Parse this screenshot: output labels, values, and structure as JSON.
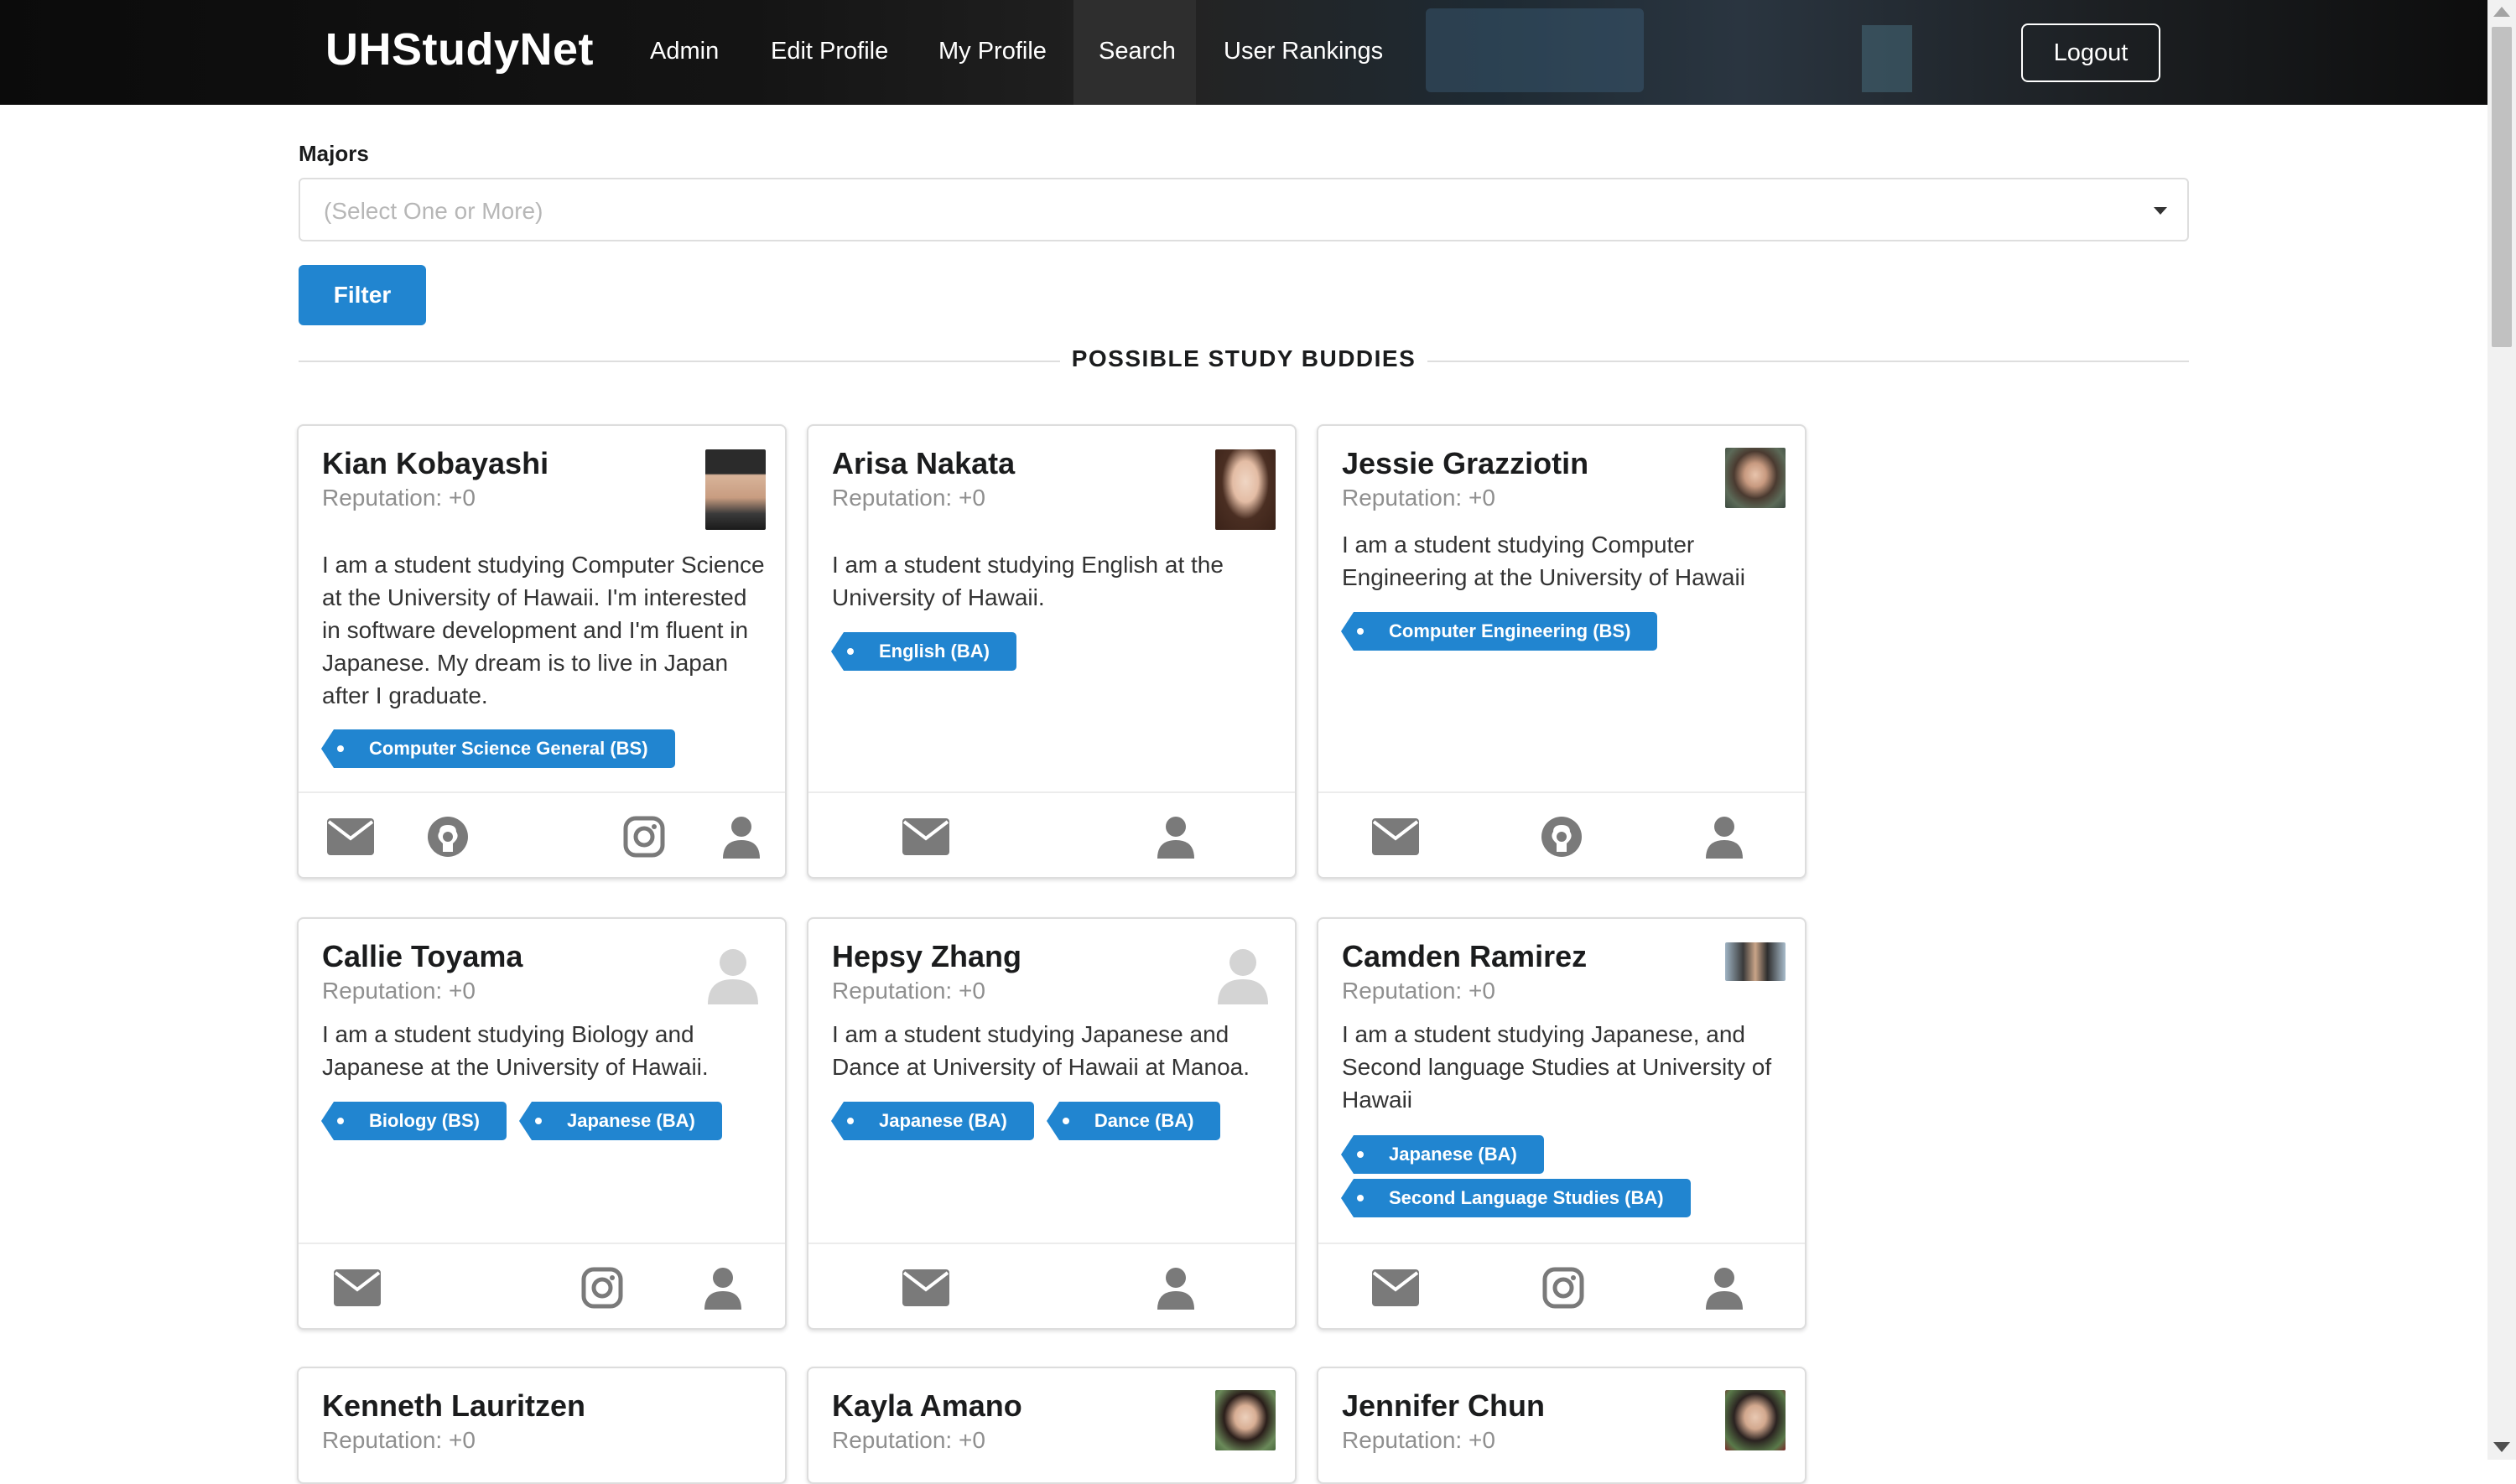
{
  "navbar": {
    "brand": "UHStudyNet",
    "items": [
      {
        "label": "Admin"
      },
      {
        "label": "Edit Profile"
      },
      {
        "label": "My Profile"
      },
      {
        "label": "Search"
      },
      {
        "label": "User Rankings"
      }
    ],
    "logout_label": "Logout"
  },
  "filter": {
    "majors_label": "Majors",
    "majors_placeholder": "(Select One or More)",
    "filter_button": "Filter"
  },
  "section_title": "POSSIBLE STUDY BUDDIES",
  "cards": [
    {
      "name": "Kian Kobayashi",
      "reputation": "Reputation: +0",
      "description": "I am a student studying Computer Science at the University of Hawaii. I'm interested in software development and I'm fluent in Japanese. My dream is to live in Japan after I graduate.",
      "tags": [
        "Computer Science General (BS)"
      ],
      "icons": [
        "mail-icon",
        "github-icon",
        "instagram-icon",
        "user-icon"
      ]
    },
    {
      "name": "Arisa Nakata",
      "reputation": "Reputation: +0",
      "description": "I am a student studying English at the University of Hawaii.",
      "tags": [
        "English (BA)"
      ],
      "icons": [
        "mail-icon",
        "user-icon"
      ]
    },
    {
      "name": "Jessie Grazziotin",
      "reputation": "Reputation: +0",
      "description": "I am a student studying Computer Engineering at the University of Hawaii",
      "tags": [
        "Computer Engineering (BS)"
      ],
      "icons": [
        "mail-icon",
        "github-icon",
        "user-icon"
      ]
    },
    {
      "name": "Callie Toyama",
      "reputation": "Reputation: +0",
      "description": "I am a student studying Biology and Japanese at the University of Hawaii.",
      "tags": [
        "Biology (BS)",
        "Japanese (BA)"
      ],
      "icons": [
        "mail-icon",
        "instagram-icon",
        "user-icon"
      ]
    },
    {
      "name": "Hepsy Zhang",
      "reputation": "Reputation: +0",
      "description": "I am a student studying Japanese and Dance at University of Hawaii at Manoa.",
      "tags": [
        "Japanese (BA)",
        "Dance (BA)"
      ],
      "icons": [
        "mail-icon",
        "user-icon"
      ]
    },
    {
      "name": "Camden Ramirez",
      "reputation": "Reputation: +0",
      "description": "I am a student studying Japanese, and Second language Studies at University of Hawaii",
      "tags": [
        "Japanese (BA)",
        "Second Language Studies (BA)"
      ],
      "icons": [
        "mail-icon",
        "instagram-icon",
        "user-icon"
      ]
    },
    {
      "name": "Kenneth Lauritzen",
      "reputation": "Reputation: +0"
    },
    {
      "name": "Kayla Amano",
      "reputation": "Reputation: +0"
    },
    {
      "name": "Jennifer Chun",
      "reputation": "Reputation: +0"
    }
  ],
  "colors": {
    "primary": "#2185d0",
    "icon_gray": "#7a7a7a",
    "muted_text": "#8f8f8f"
  }
}
